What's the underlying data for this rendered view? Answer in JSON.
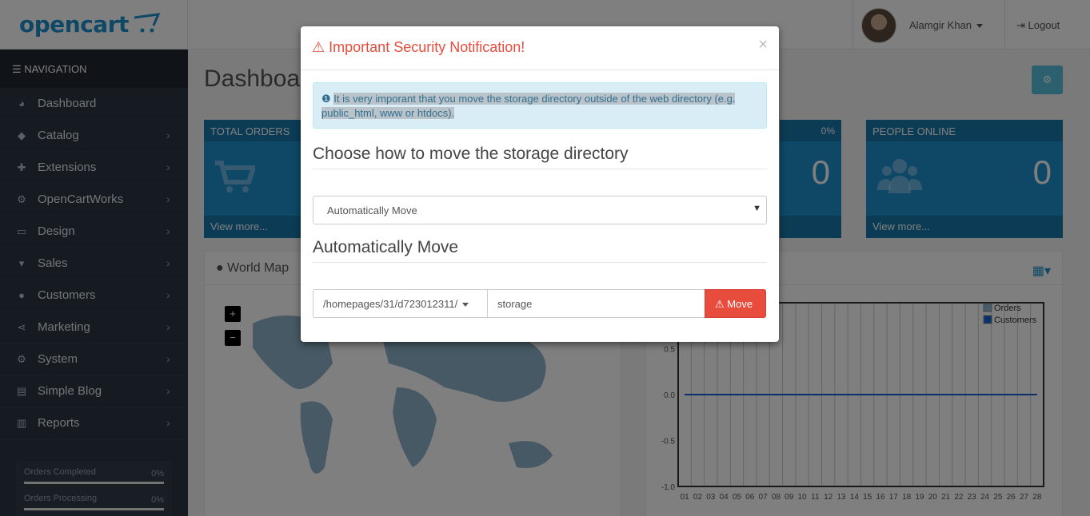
{
  "brand": {
    "logo_text": "opencart"
  },
  "header": {
    "user_name": "Alamgir Khan",
    "logout_label": "Logout"
  },
  "sidebar": {
    "nav_label": "NAVIGATION",
    "items": [
      {
        "label": "Dashboard",
        "icon": "dashboard-icon"
      },
      {
        "label": "Catalog",
        "icon": "tag-icon"
      },
      {
        "label": "Extensions",
        "icon": "puzzle-icon"
      },
      {
        "label": "OpenCartWorks",
        "icon": "cogs-icon"
      },
      {
        "label": "Design",
        "icon": "desktop-icon"
      },
      {
        "label": "Sales",
        "icon": "cart-icon"
      },
      {
        "label": "Customers",
        "icon": "user-icon"
      },
      {
        "label": "Marketing",
        "icon": "share-icon"
      },
      {
        "label": "System",
        "icon": "gear-icon"
      },
      {
        "label": "Simple Blog",
        "icon": "file-icon"
      },
      {
        "label": "Reports",
        "icon": "bar-chart-icon"
      }
    ],
    "stats": [
      {
        "label": "Orders Completed",
        "value": "0%"
      },
      {
        "label": "Orders Processing",
        "value": "0%"
      }
    ]
  },
  "dashboard": {
    "title": "Dashboard",
    "tiles": [
      {
        "title": "TOTAL ORDERS",
        "footer": "View more..."
      },
      {
        "title": "",
        "pct": "0%",
        "value": "0",
        "footer": ""
      },
      {
        "title": "PEOPLE ONLINE",
        "value": "0",
        "footer": "View more..."
      }
    ],
    "world_map_title": "World Map",
    "map_zoom_in": "+",
    "map_zoom_out": "−",
    "chart_legend": [
      "Orders",
      "Customers"
    ]
  },
  "modal": {
    "title": "Important Security Notification!",
    "close": "×",
    "alert_text": "It is very imporant that you move the storage directory outside of the web directory (e.g. public_html, www or htdocs).",
    "section1_title": "Choose how to move the storage directory",
    "select_value": "Automatically Move",
    "section2_title": "Automatically Move",
    "dir_value": "/homepages/31/d723012311/",
    "storage_value": "storage",
    "move_label": "Move"
  },
  "chart_data": {
    "type": "line",
    "categories": [
      "01",
      "02",
      "03",
      "04",
      "05",
      "06",
      "07",
      "08",
      "09",
      "10",
      "11",
      "12",
      "13",
      "14",
      "15",
      "16",
      "17",
      "18",
      "19",
      "20",
      "21",
      "22",
      "23",
      "24",
      "25",
      "26",
      "27",
      "28"
    ],
    "series": [
      {
        "name": "Orders",
        "values": [
          0,
          0,
          0,
          0,
          0,
          0,
          0,
          0,
          0,
          0,
          0,
          0,
          0,
          0,
          0,
          0,
          0,
          0,
          0,
          0,
          0,
          0,
          0,
          0,
          0,
          0,
          0,
          0
        ]
      },
      {
        "name": "Customers",
        "values": [
          0,
          0,
          0,
          0,
          0,
          0,
          0,
          0,
          0,
          0,
          0,
          0,
          0,
          0,
          0,
          0,
          0,
          0,
          0,
          0,
          0,
          0,
          0,
          0,
          0,
          0,
          0,
          0
        ]
      }
    ],
    "y_ticks": [
      "0.5",
      "0.0",
      "-0.5",
      "-1.0"
    ],
    "ylim": [
      -1.0,
      1.0
    ],
    "grid": true,
    "legend_position": "top-right"
  }
}
